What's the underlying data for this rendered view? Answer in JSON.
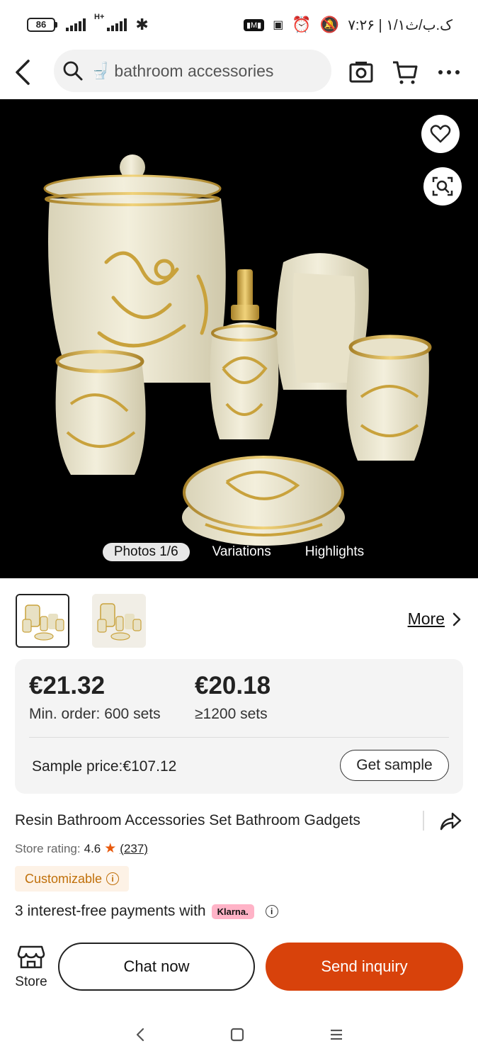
{
  "status_bar": {
    "battery": "86",
    "network": "H+",
    "time": "۷:۲۶ | ۱/۱ک.ب/ث"
  },
  "search": {
    "emoji": "🚽",
    "query": "bathroom accessories"
  },
  "gallery": {
    "tabs": [
      "Photos 1/6",
      "Variations",
      "Highlights"
    ],
    "more_label": "More"
  },
  "pricing": {
    "tiers": [
      {
        "price": "€21.32",
        "qty": "Min. order: 600 sets"
      },
      {
        "price": "€20.18",
        "qty": "≥1200 sets"
      }
    ],
    "sample_price": "Sample price:€107.12",
    "get_sample_label": "Get sample"
  },
  "product": {
    "title": "Resin Bathroom Accessories Set Bathroom Gadgets",
    "rating_label": "Store rating:",
    "rating_value": "4.6",
    "rating_count": "(237)",
    "badge": "Customizable",
    "payments_text": "3 interest-free payments with",
    "klarna_label": "Klarna."
  },
  "actions": {
    "store_label": "Store",
    "chat_label": "Chat now",
    "inquiry_label": "Send inquiry"
  },
  "colors": {
    "accent": "#d8420b",
    "badge_text": "#c0700a",
    "klarna_bg": "#ffb3c7",
    "hero_bg": "#000000"
  }
}
